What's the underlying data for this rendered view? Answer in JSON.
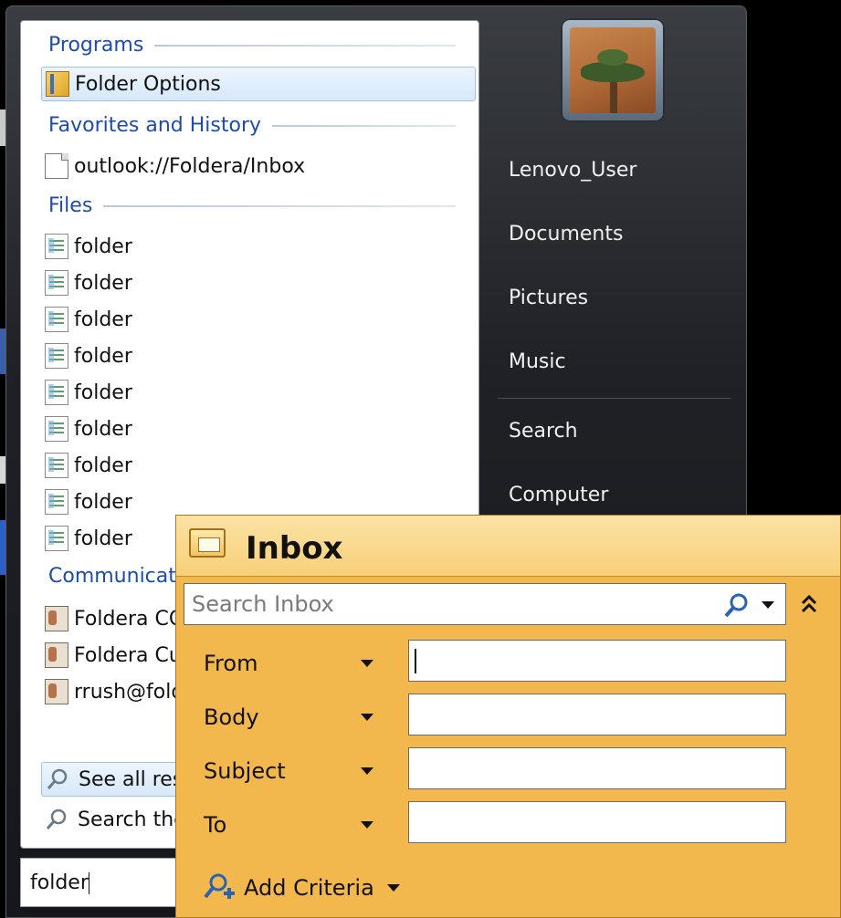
{
  "start_menu": {
    "groups": {
      "programs": {
        "title": "Programs",
        "items": [
          {
            "label": "Folder Options",
            "icon": "folder-options-icon"
          }
        ]
      },
      "favorites": {
        "title": "Favorites and History",
        "items": [
          {
            "label": "outlook://Foldera/Inbox",
            "icon": "document-icon"
          }
        ]
      },
      "files": {
        "title": "Files",
        "items": [
          {
            "label": "folder"
          },
          {
            "label": "folder"
          },
          {
            "label": "folder"
          },
          {
            "label": "folder"
          },
          {
            "label": "folder"
          },
          {
            "label": "folder"
          },
          {
            "label": "folder"
          },
          {
            "label": "folder"
          },
          {
            "label": "folder"
          }
        ]
      },
      "communications": {
        "title": "Communicat",
        "items": [
          {
            "label": "Foldera CC"
          },
          {
            "label": "Foldera Cu"
          },
          {
            "label": "rrush@fold"
          }
        ]
      }
    },
    "see_all_results": "See all resu",
    "search_the": "Search the",
    "search_query": "folder",
    "right_pane": {
      "user": "Lenovo_User",
      "items": [
        "Documents",
        "Pictures",
        "Music"
      ],
      "items2": [
        "Search",
        "Computer"
      ]
    }
  },
  "inbox_panel": {
    "title": "Inbox",
    "search_placeholder": "Search Inbox",
    "criteria": [
      {
        "label": "From",
        "value": ""
      },
      {
        "label": "Body",
        "value": ""
      },
      {
        "label": "Subject",
        "value": ""
      },
      {
        "label": "To",
        "value": ""
      }
    ],
    "add_criteria": "Add Criteria"
  },
  "colors": {
    "inbox_bg": "#f3b84d",
    "header_blue": "#1e4ca8",
    "menu_dark": "#1f2126"
  }
}
